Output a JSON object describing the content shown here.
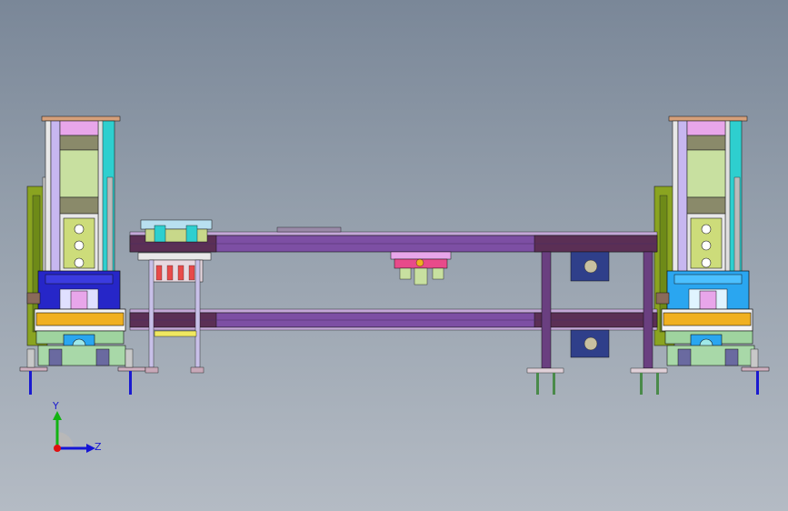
{
  "viewport": {
    "name": "cad-graphics-area"
  },
  "triad": {
    "y_label": "Y",
    "z_label": "Z",
    "y_color": "#12b312",
    "z_color": "#1515d6",
    "x_color": "#e01010"
  },
  "colors": {
    "beam_purple": "#7d4fa4",
    "beam_dark": "#5b2f55",
    "column_white": "#e6e6e6",
    "column_pink": "#e8a6ea",
    "column_olive": "#c8d48a",
    "press_blue": "#2626c8",
    "press_light_blue": "#2aa6f0",
    "bed_yellow": "#f0b020",
    "tower_cyan": "#2ecfcf",
    "olive_plate": "#8aa420"
  }
}
